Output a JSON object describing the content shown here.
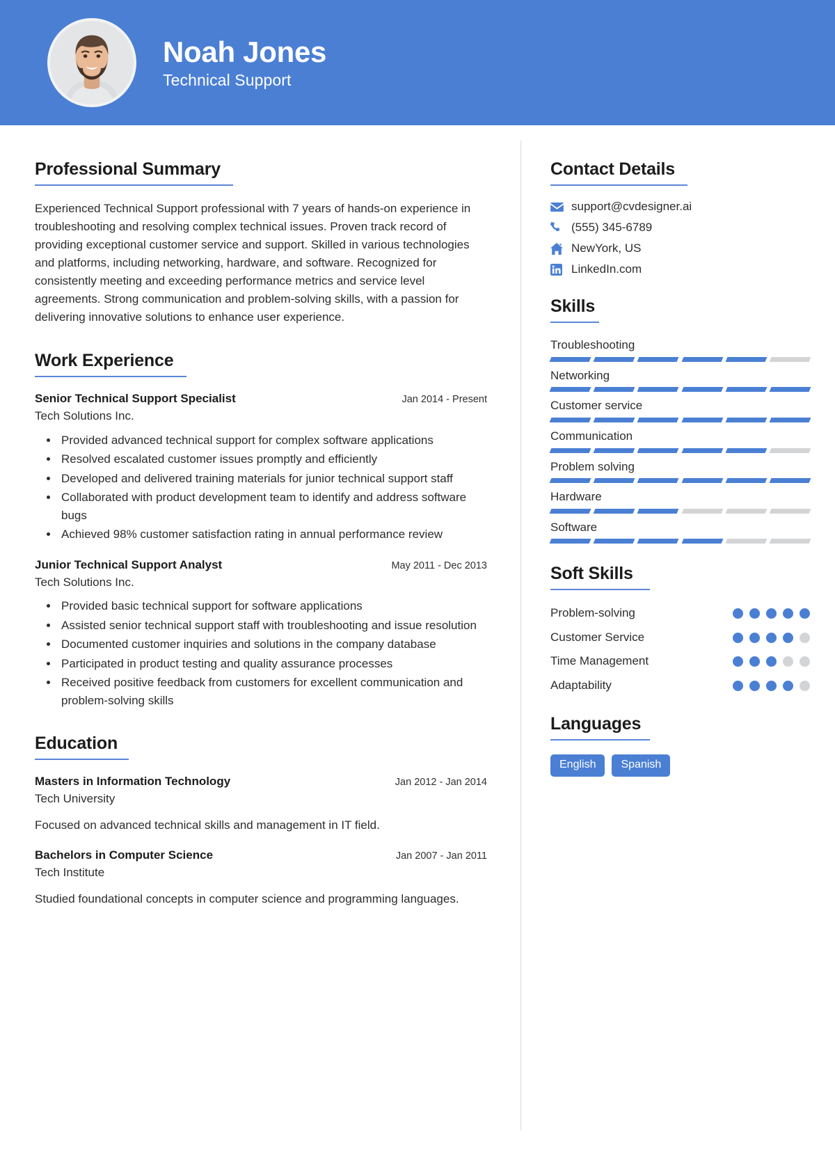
{
  "header": {
    "name": "Noah Jones",
    "title": "Technical Support",
    "avatar_icon": "profile-photo",
    "bg_color": "#4a7fd4"
  },
  "accent_color": "#4a7fd4",
  "muted_color": "#d3d4d6",
  "main": {
    "summary": {
      "title": "Professional Summary",
      "text": "Experienced Technical Support professional with 7 years of hands-on experience in troubleshooting and resolving complex technical issues. Proven track record of providing exceptional customer service and support. Skilled in various technologies and platforms, including networking, hardware, and software. Recognized for consistently meeting and exceeding performance metrics and service level agreements. Strong communication and problem-solving skills, with a passion for delivering innovative solutions to enhance user experience."
    },
    "work": {
      "title": "Work Experience",
      "entries": [
        {
          "role": "Senior Technical Support Specialist",
          "date": "Jan 2014 - Present",
          "org": "Tech Solutions Inc.",
          "bullets": [
            "Provided advanced technical support for complex software applications",
            "Resolved escalated customer issues promptly and efficiently",
            "Developed and delivered training materials for junior technical support staff",
            "Collaborated with product development team to identify and address software bugs",
            "Achieved 98% customer satisfaction rating in annual performance review"
          ]
        },
        {
          "role": "Junior Technical Support Analyst",
          "date": "May 2011 - Dec 2013",
          "org": "Tech Solutions Inc.",
          "bullets": [
            "Provided basic technical support for software applications",
            "Assisted senior technical support staff with troubleshooting and issue resolution",
            "Documented customer inquiries and solutions in the company database",
            "Participated in product testing and quality assurance processes",
            "Received positive feedback from customers for excellent communication and problem-solving skills"
          ]
        }
      ]
    },
    "education": {
      "title": "Education",
      "entries": [
        {
          "degree": "Masters in Information Technology",
          "date": "Jan 2012 - Jan 2014",
          "school": "Tech University",
          "description": "Focused on advanced technical skills and management in IT field."
        },
        {
          "degree": "Bachelors in Computer Science",
          "date": "Jan 2007 - Jan 2011",
          "school": "Tech Institute",
          "description": "Studied foundational concepts in computer science and programming languages."
        }
      ]
    }
  },
  "sidebar": {
    "contact": {
      "title": "Contact Details",
      "items": [
        {
          "icon": "envelope-icon",
          "value": "support@cvdesigner.ai"
        },
        {
          "icon": "phone-icon",
          "value": "(555) 345-6789"
        },
        {
          "icon": "home-icon",
          "value": "NewYork, US"
        },
        {
          "icon": "linkedin-icon",
          "value": "LinkedIn.com"
        }
      ]
    },
    "skills": {
      "title": "Skills",
      "max_segments": 6,
      "items": [
        {
          "name": "Troubleshooting",
          "level": 5
        },
        {
          "name": "Networking",
          "level": 6
        },
        {
          "name": "Customer service",
          "level": 6
        },
        {
          "name": "Communication",
          "level": 5
        },
        {
          "name": "Problem solving",
          "level": 6
        },
        {
          "name": "Hardware",
          "level": 3
        },
        {
          "name": "Software",
          "level": 4
        }
      ]
    },
    "soft_skills": {
      "title": "Soft Skills",
      "max_dots": 5,
      "items": [
        {
          "name": "Problem-solving",
          "level": 5
        },
        {
          "name": "Customer Service",
          "level": 4
        },
        {
          "name": "Time Management",
          "level": 3
        },
        {
          "name": "Adaptability",
          "level": 4
        }
      ]
    },
    "languages": {
      "title": "Languages",
      "items": [
        "English",
        "Spanish"
      ]
    }
  }
}
